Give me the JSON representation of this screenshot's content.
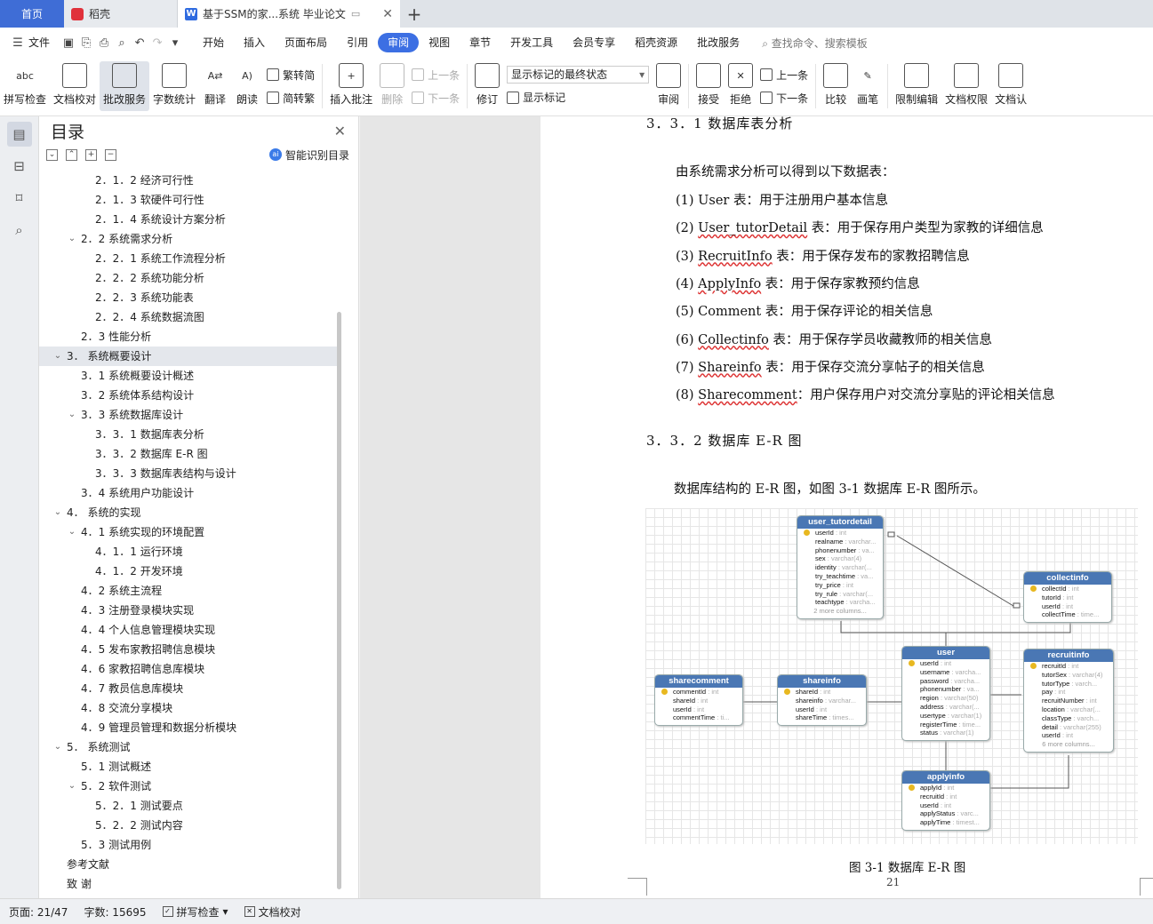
{
  "tabs": {
    "home": "首页",
    "daoke": "稻壳",
    "doc": "基于SSM的家...系统 毕业论文"
  },
  "menu": {
    "file": "文件",
    "items": [
      "开始",
      "插入",
      "页面布局",
      "引用",
      "审阅",
      "视图",
      "章节",
      "开发工具",
      "会员专享",
      "稻壳资源",
      "批改服务"
    ],
    "active": "审阅",
    "search": "查找命令、搜索模板"
  },
  "ribbon": {
    "spell": "拼写检查",
    "proof": "文档校对",
    "revise_service": "批改服务",
    "wordcount": "字数统计",
    "translate": "翻译",
    "read": "朗读",
    "trad": "繁转简",
    "simp": "简转繁",
    "insert_comment": "插入批注",
    "delete": "删除",
    "prev_a": "上一条",
    "next_a": "下一条",
    "track": "修订",
    "markup_state": "显示标记的最终状态",
    "show_markup": "显示标记",
    "review": "审阅",
    "accept": "接受",
    "reject": "拒绝",
    "prev_b": "上一条",
    "next_b": "下一条",
    "compare": "比较",
    "pen": "画笔",
    "restrict": "限制编辑",
    "perm": "文档权限",
    "auth": "文档认"
  },
  "toc": {
    "title": "目录",
    "smart": "智能识别目录",
    "items": [
      {
        "text": "2．1．2 经济可行性",
        "level": 3
      },
      {
        "text": "2．1．3 软硬件可行性",
        "level": 3
      },
      {
        "text": "2．1．4 系统设计方案分析",
        "level": 3
      },
      {
        "text": "2．2 系统需求分析",
        "level": 2,
        "open": true
      },
      {
        "text": "2．2．1 系统工作流程分析",
        "level": 3
      },
      {
        "text": "2．2．2 系统功能分析",
        "level": 3
      },
      {
        "text": "2．2．3 系统功能表",
        "level": 3
      },
      {
        "text": "2．2．4 系统数据流图",
        "level": 3
      },
      {
        "text": "2．3 性能分析",
        "level": 2
      },
      {
        "text": "3．  系统概要设计",
        "level": 1,
        "open": true,
        "selected": true
      },
      {
        "text": "3．1 系统概要设计概述",
        "level": 2
      },
      {
        "text": "3．2 系统体系结构设计",
        "level": 2
      },
      {
        "text": "3．3 系统数据库设计",
        "level": 2,
        "open": true
      },
      {
        "text": "3．3．1 数据库表分析",
        "level": 3
      },
      {
        "text": "3．3．2 数据库 E-R 图",
        "level": 3
      },
      {
        "text": "3．3．3 数据库表结构与设计",
        "level": 3
      },
      {
        "text": "3．4 系统用户功能设计",
        "level": 2
      },
      {
        "text": "4．  系统的实现",
        "level": 1,
        "open": true
      },
      {
        "text": "4．1 系统实现的环境配置",
        "level": 2,
        "open": true
      },
      {
        "text": "4．1．1 运行环境",
        "level": 3
      },
      {
        "text": "4．1．2 开发环境",
        "level": 3
      },
      {
        "text": "4．2 系统主流程",
        "level": 2
      },
      {
        "text": "4．3 注册登录模块实现",
        "level": 2
      },
      {
        "text": "4．4 个人信息管理模块实现",
        "level": 2
      },
      {
        "text": "4．5 发布家教招聘信息模块",
        "level": 2
      },
      {
        "text": "4．6 家教招聘信息库模块",
        "level": 2
      },
      {
        "text": "4．7 教员信息库模块",
        "level": 2
      },
      {
        "text": "4．8 交流分享模块",
        "level": 2
      },
      {
        "text": "4．9 管理员管理和数据分析模块",
        "level": 2
      },
      {
        "text": "5．  系统测试",
        "level": 1,
        "open": true
      },
      {
        "text": "5．1 测试概述",
        "level": 2
      },
      {
        "text": "5．2 软件测试",
        "level": 2,
        "open": true
      },
      {
        "text": "5．2．1 测试要点",
        "level": 3
      },
      {
        "text": "5．2．2 测试内容",
        "level": 3
      },
      {
        "text": "5．3 测试用例",
        "level": 2
      },
      {
        "text": "参考文献",
        "level": 0
      },
      {
        "text": "致  谢",
        "level": 0
      }
    ]
  },
  "doc": {
    "h331": "3．3．1 数据库表分析",
    "intro": "由系统需求分析可以得到以下数据表：",
    "list": [
      {
        "n": "(1)",
        "name": "User",
        "sep": " 表：",
        "desc": "用于注册用户基本信息",
        "ul": false
      },
      {
        "n": "(2)",
        "name": "User_tutorDetail",
        "sep": " 表：",
        "desc": "用于保存用户类型为家教的详细信息",
        "ul": true
      },
      {
        "n": "(3)",
        "name": "RecruitInfo",
        "sep": " 表：",
        "desc": "用于保存发布的家教招聘信息",
        "ul": true
      },
      {
        "n": "(4)",
        "name": "ApplyInfo",
        "sep": " 表：",
        "desc": "用于保存家教预约信息",
        "ul": true
      },
      {
        "n": "(5)",
        "name": "Comment",
        "sep": " 表：",
        "desc": "用于保存评论的相关信息",
        "ul": false
      },
      {
        "n": "(6)",
        "name": "Collectinfo",
        "sep": " 表：",
        "desc": "用于保存学员收藏教师的相关信息",
        "ul": true
      },
      {
        "n": "(7)",
        "name": "Shareinfo",
        "sep": " 表：",
        "desc": "用于保存交流分享帖子的相关信息",
        "ul": true
      },
      {
        "n": "(8)",
        "name": "Sharecomment",
        "sep": "：",
        "desc": "用户保存用户对交流分享贴的评论相关信息",
        "ul": true
      }
    ],
    "h332": "3．3．2 数据库 E-R 图",
    "er_intro": "数据库结构的 E-R 图，如图 3-1 数据库 E-R 图所示。",
    "caption": "图 3-1 数据库 E-R 图",
    "page_number": "21"
  },
  "er": {
    "user_tutordetail": {
      "title": "user_tutordetail",
      "fields": [
        [
          "userId",
          "int",
          true
        ],
        [
          "realname",
          "varchar..."
        ],
        [
          "phonenumber",
          "va..."
        ],
        [
          "sex",
          "varchar(4)"
        ],
        [
          "identity",
          "varchar(..."
        ],
        [
          "try_teachtime",
          "va..."
        ],
        [
          "try_price",
          "int"
        ],
        [
          "try_rule",
          "varchar(..."
        ],
        [
          "teachtype",
          "varcha..."
        ]
      ],
      "more": "2 more columns..."
    },
    "collectinfo": {
      "title": "collectinfo",
      "fields": [
        [
          "collectId",
          "int",
          true
        ],
        [
          "tutorId",
          "int"
        ],
        [
          "userId",
          "int"
        ],
        [
          "collectTime",
          "time..."
        ]
      ]
    },
    "user": {
      "title": "user",
      "fields": [
        [
          "userId",
          "int",
          true
        ],
        [
          "username",
          "varcha..."
        ],
        [
          "password",
          "varcha..."
        ],
        [
          "phonenumber",
          "va..."
        ],
        [
          "region",
          "varchar(50)"
        ],
        [
          "address",
          "varchar(..."
        ],
        [
          "usertype",
          "varchar(1)"
        ],
        [
          "registerTime",
          "time..."
        ],
        [
          "status",
          "varchar(1)"
        ]
      ]
    },
    "recruitinfo": {
      "title": "recruitinfo",
      "fields": [
        [
          "recruitId",
          "int",
          true
        ],
        [
          "tutorSex",
          "varchar(4)"
        ],
        [
          "tutorType",
          "varch..."
        ],
        [
          "pay",
          "int"
        ],
        [
          "recruitNumber",
          "int"
        ],
        [
          "location",
          "varchar(..."
        ],
        [
          "classType",
          "varch..."
        ],
        [
          "detail",
          "varchar(255)"
        ],
        [
          "userId",
          "int"
        ]
      ],
      "more": "6 more columns..."
    },
    "sharecomment": {
      "title": "sharecomment",
      "fields": [
        [
          "commentId",
          "int",
          true
        ],
        [
          "shareId",
          "int"
        ],
        [
          "userId",
          "int"
        ],
        [
          "commentTime",
          "ti..."
        ]
      ]
    },
    "shareinfo": {
      "title": "shareinfo",
      "fields": [
        [
          "shareId",
          "int",
          true
        ],
        [
          "shareinfo",
          "varchar..."
        ],
        [
          "userId",
          "int"
        ],
        [
          "shareTime",
          "times..."
        ]
      ]
    },
    "applyinfo": {
      "title": "applyinfo",
      "fields": [
        [
          "applyId",
          "int",
          true
        ],
        [
          "recruitId",
          "int"
        ],
        [
          "userId",
          "int"
        ],
        [
          "applyStatus",
          "varc..."
        ],
        [
          "applyTime",
          "timest..."
        ]
      ]
    }
  },
  "status": {
    "page": "页面: 21/47",
    "words": "字数: 15695",
    "spell": "拼写检查",
    "proof": "文档校对"
  }
}
